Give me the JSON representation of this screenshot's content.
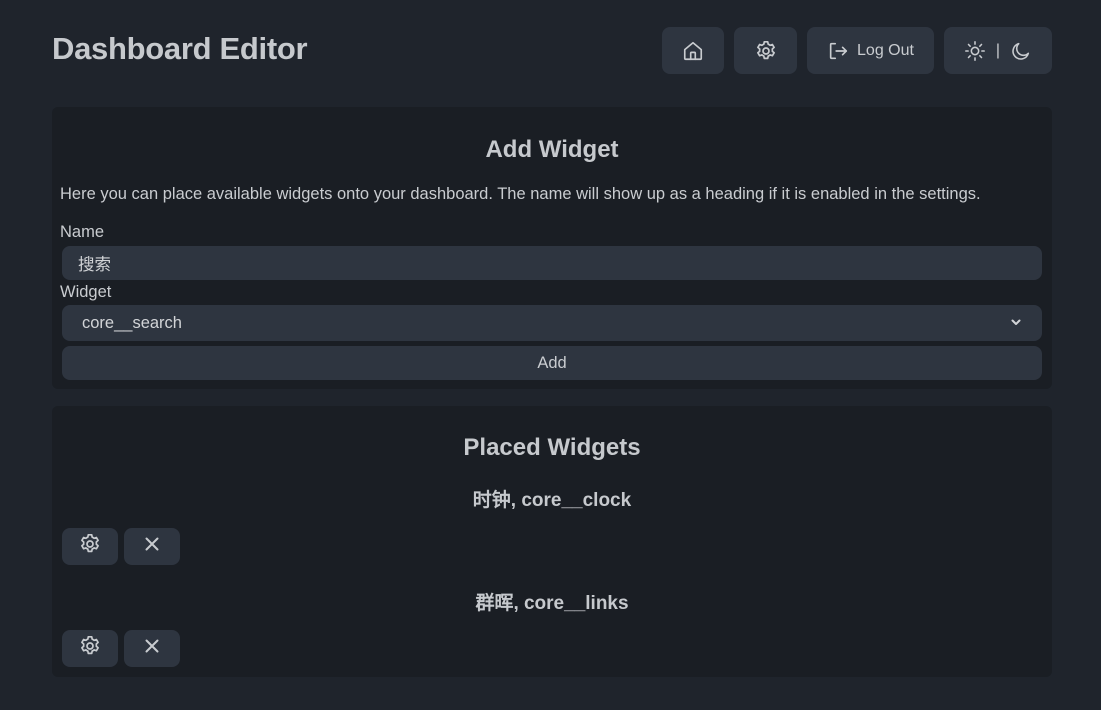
{
  "header": {
    "title": "Dashboard Editor",
    "home_icon": "home-icon",
    "settings_icon": "gear-icon",
    "logout_label": "Log Out",
    "logout_icon": "logout-icon",
    "theme_separator": "|",
    "theme_icons": [
      "sun-icon",
      "moon-icon"
    ]
  },
  "add_widget": {
    "title": "Add Widget",
    "description": "Here you can place available widgets onto your dashboard. The name will show up as a heading if it is enabled in the settings.",
    "name_label": "Name",
    "name_value": "搜索",
    "widget_label": "Widget",
    "widget_selected": "core__search",
    "add_label": "Add"
  },
  "placed_widgets": {
    "title": "Placed Widgets",
    "items": [
      {
        "heading": "时钟, core__clock"
      },
      {
        "heading": "群晖, core__links"
      }
    ]
  },
  "colors": {
    "background": "#1f242c",
    "card": "#1a1e24",
    "button": "#2e3540",
    "text": "#c9ccd0"
  }
}
